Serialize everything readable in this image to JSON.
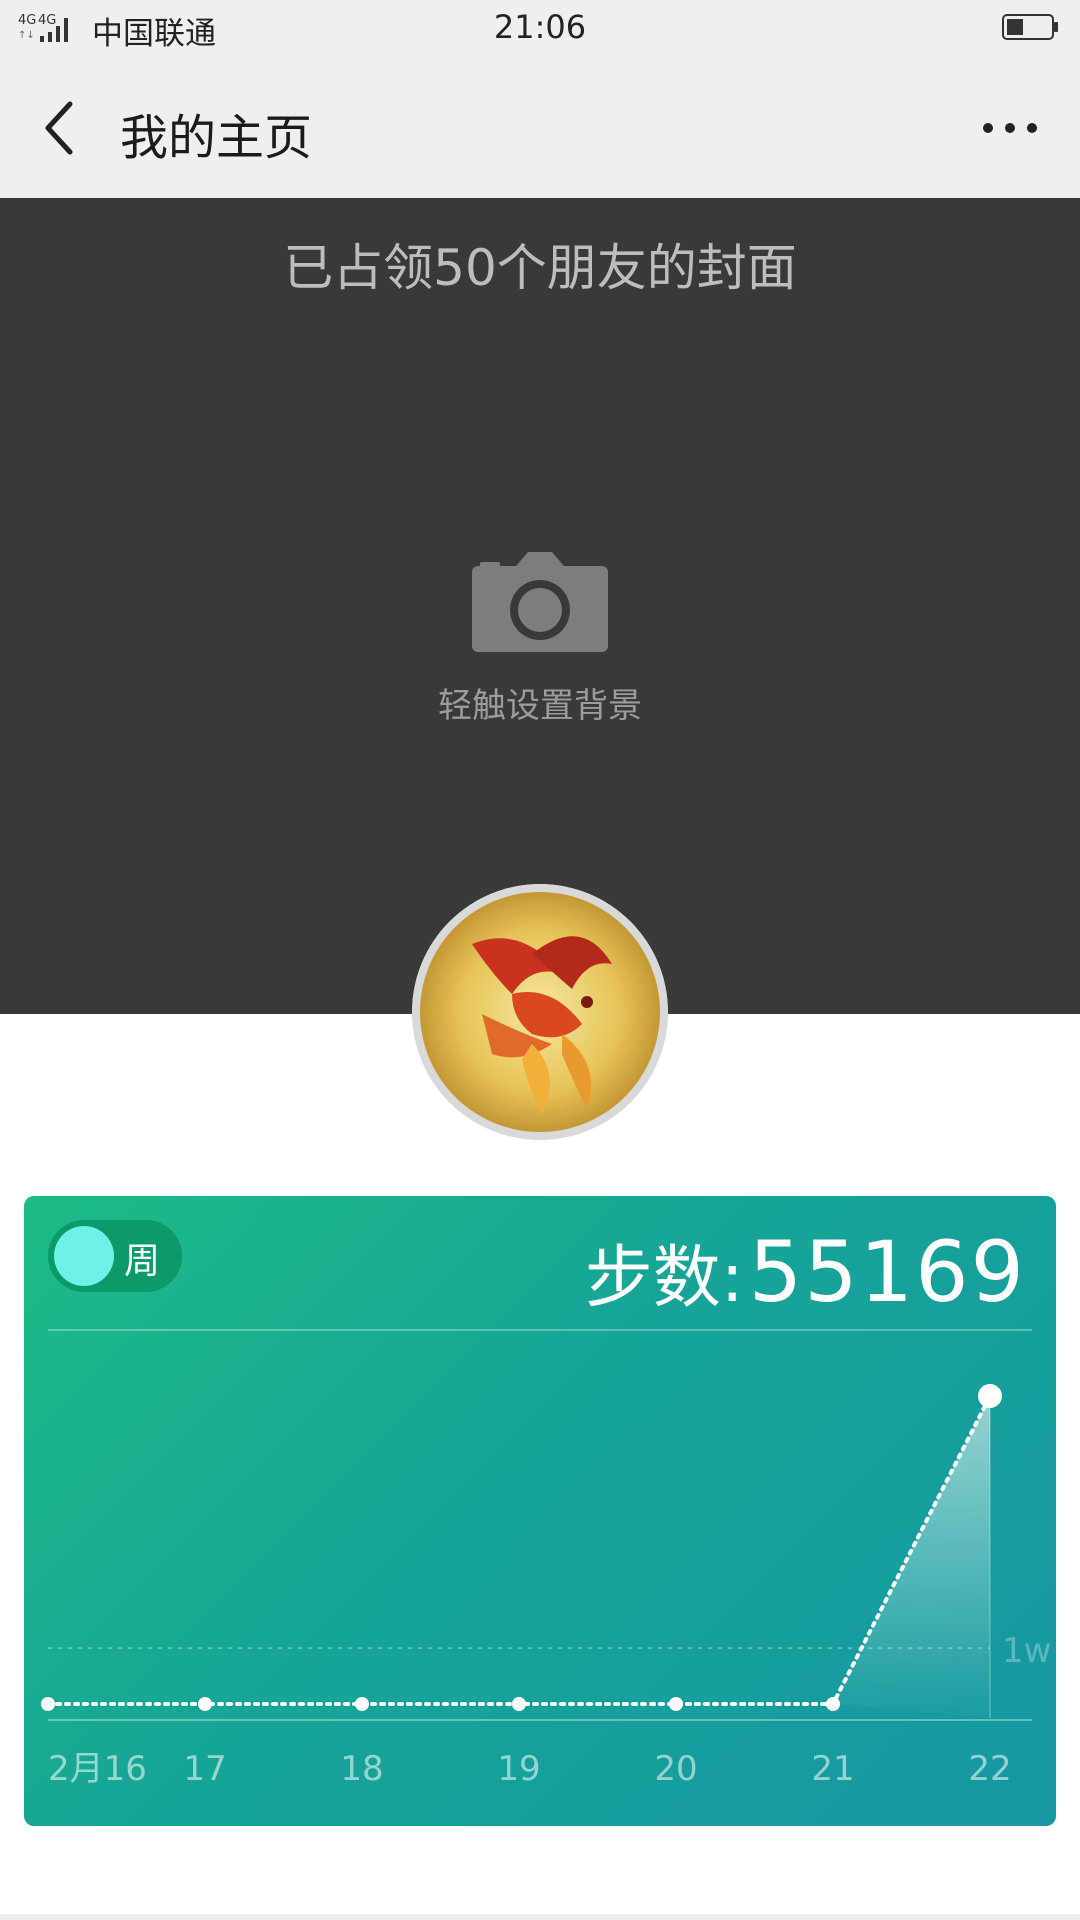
{
  "status_bar": {
    "carrier": "中国联通",
    "network": "4G",
    "time": "21:06"
  },
  "nav": {
    "title": "我的主页"
  },
  "cover": {
    "headline": "已占领50个朋友的封面",
    "hint": "轻触设置背景"
  },
  "steps_card": {
    "period_label": "周",
    "steps_label": "步数:",
    "steps_value": "55169",
    "colors": {
      "gradient_start": "#1dbb86",
      "gradient_end": "#1697a3",
      "toggle_knob": "#6ff2e6"
    }
  },
  "chart_data": {
    "type": "line",
    "categories": [
      "2月16",
      "17",
      "18",
      "19",
      "20",
      "21",
      "22"
    ],
    "series": [
      {
        "values": [
          0,
          0,
          0,
          0,
          0,
          0,
          55169
        ]
      }
    ],
    "reference_line": {
      "label": "1w",
      "value": 10000
    },
    "ylim": [
      0,
      55169
    ],
    "grid": false,
    "xlabel": "",
    "ylabel": ""
  }
}
